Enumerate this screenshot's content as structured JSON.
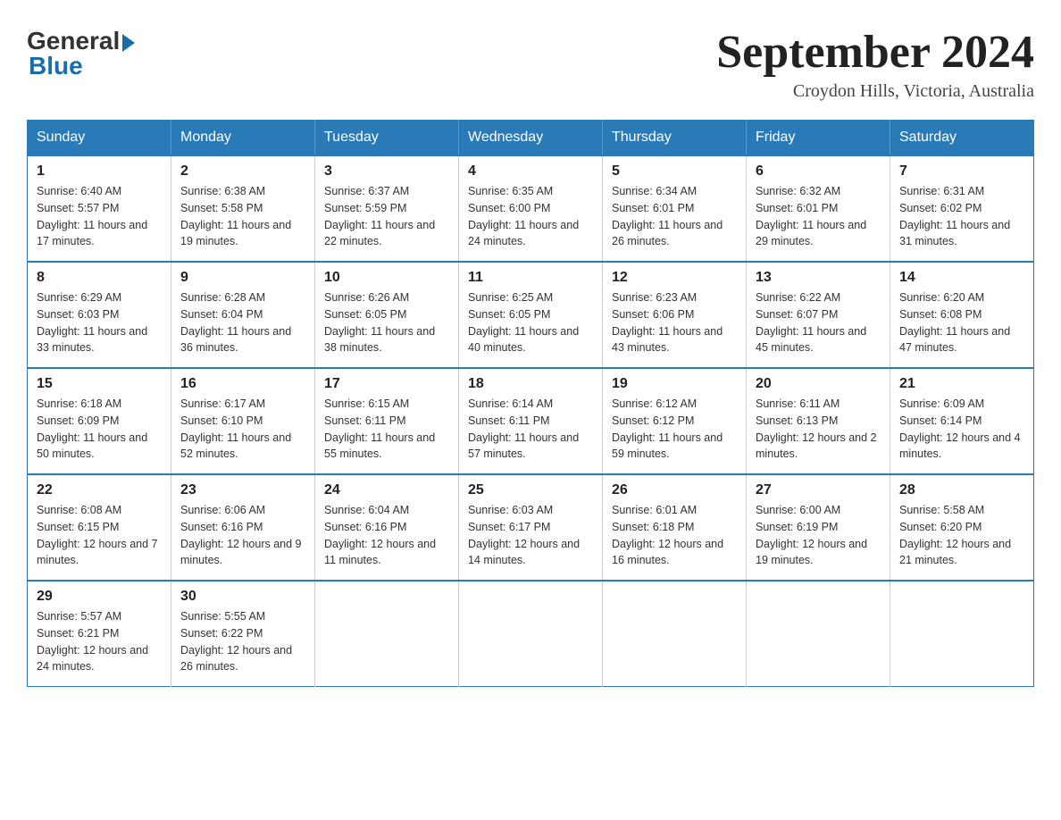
{
  "header": {
    "logo_general": "General",
    "logo_blue": "Blue",
    "month_title": "September 2024",
    "location": "Croydon Hills, Victoria, Australia"
  },
  "calendar": {
    "weekdays": [
      "Sunday",
      "Monday",
      "Tuesday",
      "Wednesday",
      "Thursday",
      "Friday",
      "Saturday"
    ],
    "weeks": [
      [
        {
          "day": "1",
          "sunrise": "6:40 AM",
          "sunset": "5:57 PM",
          "daylight": "11 hours and 17 minutes."
        },
        {
          "day": "2",
          "sunrise": "6:38 AM",
          "sunset": "5:58 PM",
          "daylight": "11 hours and 19 minutes."
        },
        {
          "day": "3",
          "sunrise": "6:37 AM",
          "sunset": "5:59 PM",
          "daylight": "11 hours and 22 minutes."
        },
        {
          "day": "4",
          "sunrise": "6:35 AM",
          "sunset": "6:00 PM",
          "daylight": "11 hours and 24 minutes."
        },
        {
          "day": "5",
          "sunrise": "6:34 AM",
          "sunset": "6:01 PM",
          "daylight": "11 hours and 26 minutes."
        },
        {
          "day": "6",
          "sunrise": "6:32 AM",
          "sunset": "6:01 PM",
          "daylight": "11 hours and 29 minutes."
        },
        {
          "day": "7",
          "sunrise": "6:31 AM",
          "sunset": "6:02 PM",
          "daylight": "11 hours and 31 minutes."
        }
      ],
      [
        {
          "day": "8",
          "sunrise": "6:29 AM",
          "sunset": "6:03 PM",
          "daylight": "11 hours and 33 minutes."
        },
        {
          "day": "9",
          "sunrise": "6:28 AM",
          "sunset": "6:04 PM",
          "daylight": "11 hours and 36 minutes."
        },
        {
          "day": "10",
          "sunrise": "6:26 AM",
          "sunset": "6:05 PM",
          "daylight": "11 hours and 38 minutes."
        },
        {
          "day": "11",
          "sunrise": "6:25 AM",
          "sunset": "6:05 PM",
          "daylight": "11 hours and 40 minutes."
        },
        {
          "day": "12",
          "sunrise": "6:23 AM",
          "sunset": "6:06 PM",
          "daylight": "11 hours and 43 minutes."
        },
        {
          "day": "13",
          "sunrise": "6:22 AM",
          "sunset": "6:07 PM",
          "daylight": "11 hours and 45 minutes."
        },
        {
          "day": "14",
          "sunrise": "6:20 AM",
          "sunset": "6:08 PM",
          "daylight": "11 hours and 47 minutes."
        }
      ],
      [
        {
          "day": "15",
          "sunrise": "6:18 AM",
          "sunset": "6:09 PM",
          "daylight": "11 hours and 50 minutes."
        },
        {
          "day": "16",
          "sunrise": "6:17 AM",
          "sunset": "6:10 PM",
          "daylight": "11 hours and 52 minutes."
        },
        {
          "day": "17",
          "sunrise": "6:15 AM",
          "sunset": "6:11 PM",
          "daylight": "11 hours and 55 minutes."
        },
        {
          "day": "18",
          "sunrise": "6:14 AM",
          "sunset": "6:11 PM",
          "daylight": "11 hours and 57 minutes."
        },
        {
          "day": "19",
          "sunrise": "6:12 AM",
          "sunset": "6:12 PM",
          "daylight": "11 hours and 59 minutes."
        },
        {
          "day": "20",
          "sunrise": "6:11 AM",
          "sunset": "6:13 PM",
          "daylight": "12 hours and 2 minutes."
        },
        {
          "day": "21",
          "sunrise": "6:09 AM",
          "sunset": "6:14 PM",
          "daylight": "12 hours and 4 minutes."
        }
      ],
      [
        {
          "day": "22",
          "sunrise": "6:08 AM",
          "sunset": "6:15 PM",
          "daylight": "12 hours and 7 minutes."
        },
        {
          "day": "23",
          "sunrise": "6:06 AM",
          "sunset": "6:16 PM",
          "daylight": "12 hours and 9 minutes."
        },
        {
          "day": "24",
          "sunrise": "6:04 AM",
          "sunset": "6:16 PM",
          "daylight": "12 hours and 11 minutes."
        },
        {
          "day": "25",
          "sunrise": "6:03 AM",
          "sunset": "6:17 PM",
          "daylight": "12 hours and 14 minutes."
        },
        {
          "day": "26",
          "sunrise": "6:01 AM",
          "sunset": "6:18 PM",
          "daylight": "12 hours and 16 minutes."
        },
        {
          "day": "27",
          "sunrise": "6:00 AM",
          "sunset": "6:19 PM",
          "daylight": "12 hours and 19 minutes."
        },
        {
          "day": "28",
          "sunrise": "5:58 AM",
          "sunset": "6:20 PM",
          "daylight": "12 hours and 21 minutes."
        }
      ],
      [
        {
          "day": "29",
          "sunrise": "5:57 AM",
          "sunset": "6:21 PM",
          "daylight": "12 hours and 24 minutes."
        },
        {
          "day": "30",
          "sunrise": "5:55 AM",
          "sunset": "6:22 PM",
          "daylight": "12 hours and 26 minutes."
        },
        null,
        null,
        null,
        null,
        null
      ]
    ]
  }
}
